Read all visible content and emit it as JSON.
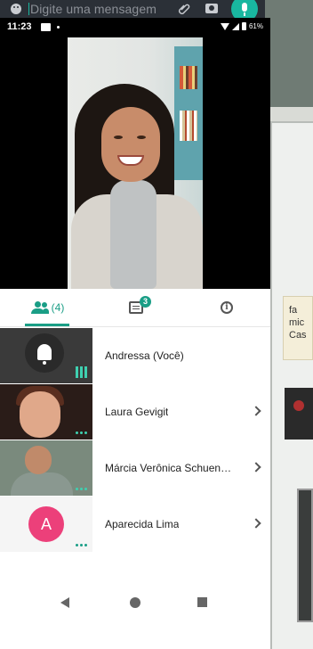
{
  "messenger": {
    "input_placeholder": "Digite uma mensagem"
  },
  "background_photo": {
    "note_text": "fa mic Cas"
  },
  "status_bar": {
    "time": "11:23",
    "battery": "61%"
  },
  "meeting": {
    "tabs": {
      "participants_count": "(4)",
      "chat_badge": "3"
    },
    "participants": [
      {
        "name": "Andressa (Você)",
        "speaking": true
      },
      {
        "name": "Laura Gevigit"
      },
      {
        "name": "Márcia Verônica Schuencke"
      },
      {
        "name": "Aparecida Lima",
        "avatar_letter": "A",
        "avatar_color": "#ec407a"
      }
    ]
  },
  "colors": {
    "accent": "#1a9e86",
    "indicator": "#3fd0b0"
  }
}
